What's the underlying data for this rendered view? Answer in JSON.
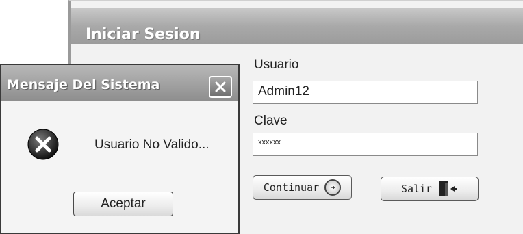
{
  "login_window": {
    "title": "Iniciar Sesion",
    "usuario_label": "Usuario",
    "usuario_value": "Admin12",
    "clave_label": "Clave",
    "clave_value": "xxxxxx",
    "continuar_label": "Continuar",
    "continuar_icon": "arrow-right-circle-icon",
    "salir_label": "Salir",
    "salir_icon": "door-exit-icon"
  },
  "message_dialog": {
    "title": "Mensaje Del Sistema",
    "message": "Usuario No Valido...",
    "icon": "error-x-icon",
    "accept_label": "Aceptar"
  }
}
